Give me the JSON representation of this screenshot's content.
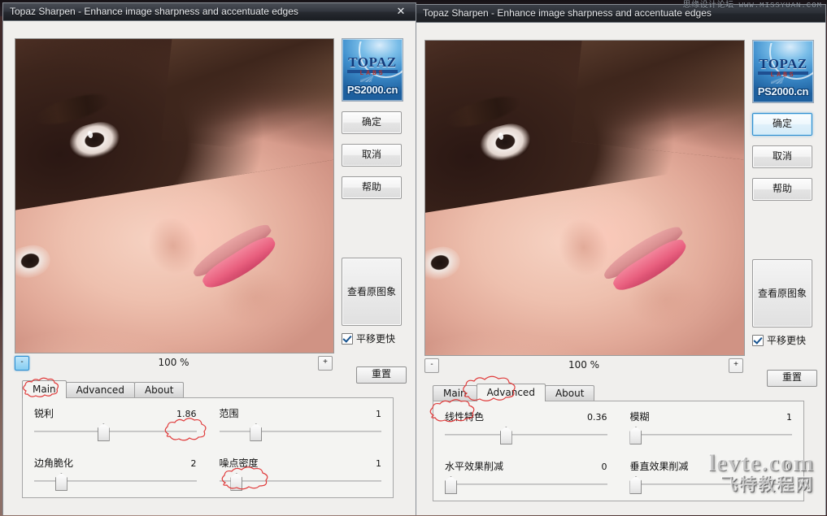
{
  "watermarks": {
    "top_right_cn": "思缘设计论坛",
    "top_right_en": "WWW.MISSYUAN.COM",
    "bottom_line1": "levte.com",
    "bottom_line2": "飞特教程网"
  },
  "left_dialog": {
    "title": "Topaz Sharpen - Enhance image sharpness and accentuate edges",
    "close_label": "✕",
    "logo": {
      "topaz": "TOPAZ",
      "labs": "LABS",
      "site": "PS2000.cn"
    },
    "buttons": {
      "ok": "确定",
      "cancel": "取消",
      "help": "帮助",
      "view_original": "查看原图象",
      "reset": "重置"
    },
    "checkbox": {
      "label": "平移更快",
      "checked": true
    },
    "zoom": {
      "minus": "-",
      "value": "100 %",
      "plus": "+",
      "minus_focused": true,
      "plus_focused": false
    },
    "tabs": [
      {
        "label": "Main",
        "active": true
      },
      {
        "label": "Advanced",
        "active": false
      },
      {
        "label": "About",
        "active": false
      }
    ],
    "sliders": [
      {
        "label": "锐利",
        "value": "1.86",
        "pos": 42,
        "label_circled": false,
        "value_circled": true
      },
      {
        "label": "范围",
        "value": "1",
        "pos": 22,
        "label_circled": false,
        "value_circled": false
      },
      {
        "label": "边角脆化",
        "value": "2",
        "pos": 16,
        "label_circled": false,
        "value_circled": false
      },
      {
        "label": "噪点密度",
        "value": "1",
        "pos": 10,
        "label_circled": true,
        "value_circled": false
      }
    ]
  },
  "right_dialog": {
    "title": "Topaz Sharpen - Enhance image sharpness and accentuate edges",
    "logo": {
      "topaz": "TOPAZ",
      "labs": "LABS",
      "site": "PS2000.cn"
    },
    "buttons": {
      "ok": "确定",
      "cancel": "取消",
      "help": "帮助",
      "view_original": "查看原图象",
      "reset": "重置"
    },
    "ok_focused": true,
    "checkbox": {
      "label": "平移更快",
      "checked": true
    },
    "zoom": {
      "minus": "-",
      "value": "100 %",
      "plus": "+",
      "minus_focused": false,
      "plus_focused": false
    },
    "tabs": [
      {
        "label": "Main",
        "active": false
      },
      {
        "label": "Advanced",
        "active": true
      },
      {
        "label": "About",
        "active": false
      }
    ],
    "sliders": [
      {
        "label": "线性特色",
        "value": "0.36",
        "pos": 37,
        "label_circled": true,
        "value_circled": false
      },
      {
        "label": "模糊",
        "value": "1",
        "pos": 3,
        "label_circled": false,
        "value_circled": false
      },
      {
        "label": "水平效果削减",
        "value": "0",
        "pos": 3,
        "label_circled": false,
        "value_circled": false
      },
      {
        "label": "垂直效果削减",
        "value": "0",
        "pos": 3,
        "label_circled": false,
        "value_circled": false
      }
    ]
  }
}
